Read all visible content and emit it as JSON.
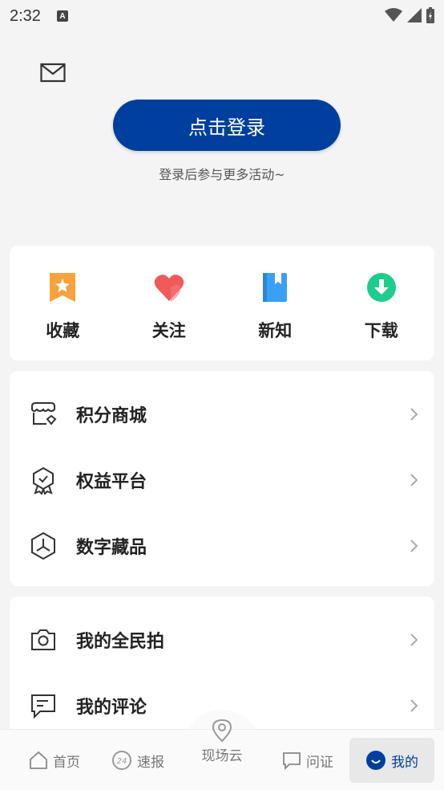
{
  "status_bar": {
    "time": "2:32",
    "notification_glyph": "A"
  },
  "header": {
    "login_button": "点击登录",
    "login_tip": "登录后参与更多活动~"
  },
  "quick_actions": [
    {
      "label": "收藏",
      "icon": "bookmark-star-icon",
      "color": "#f7a23b"
    },
    {
      "label": "关注",
      "icon": "heart-icon",
      "color": "#f05a5a"
    },
    {
      "label": "新知",
      "icon": "book-icon",
      "color": "#3aa0f5"
    },
    {
      "label": "下载",
      "icon": "download-icon",
      "color": "#1ccd8d"
    }
  ],
  "menu_group_1": [
    {
      "label": "积分商城",
      "icon": "points-shop-icon"
    },
    {
      "label": "权益平台",
      "icon": "ribbon-badge-icon"
    },
    {
      "label": "数字藏品",
      "icon": "digital-collectible-icon"
    }
  ],
  "menu_group_2": [
    {
      "label": "我的全民拍",
      "icon": "camera-icon"
    },
    {
      "label": "我的评论",
      "icon": "comment-icon"
    }
  ],
  "tab_bar": {
    "home": "首页",
    "news": "速报",
    "center": "现场云",
    "qa": "问证",
    "mine": "我的",
    "active_tab": "我的",
    "accent_color": "#003f9e"
  }
}
